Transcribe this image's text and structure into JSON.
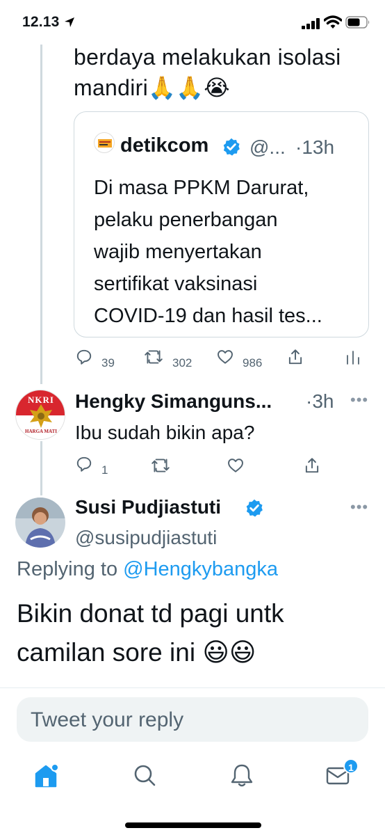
{
  "status_bar": {
    "time": "12.13"
  },
  "parent_tweet": {
    "text_line1": "berdaya melakukan isolasi",
    "text_line2": "mandiri🙏🙏😭",
    "quote": {
      "name": "detikcom",
      "handle": "@...",
      "time": "·13h",
      "lines": [
        "Di masa PPKM Darurat,",
        "pelaku penerbangan",
        "wajib menyertakan",
        "sertifikat vaksinasi",
        "COVID-19 dan hasil tes..."
      ]
    },
    "actions": {
      "replies": "39",
      "retweets": "302",
      "likes": "986"
    }
  },
  "reply_tweet": {
    "name": "Hengky Simanguns...",
    "time": "·3h",
    "avatar_text_top": "NKRI",
    "avatar_text_bottom": "HARGA MATI",
    "text": "Ibu sudah bikin apa?",
    "actions": {
      "replies": "1"
    }
  },
  "main_tweet": {
    "name": "Susi Pudjiastuti",
    "handle": "@susipudjiastuti",
    "replying_prefix": "Replying to ",
    "replying_mention": "@Hengkybangka",
    "text_line1": "Bikin donat td pagi untk",
    "text_line2": "camilan sore ini 😃😃"
  },
  "reply_input": {
    "placeholder": "Tweet your reply"
  },
  "tabbar": {
    "notifications_badge": "1"
  },
  "colors": {
    "accent": "#1d9bf0",
    "muted": "#536471",
    "text": "#0f1419"
  }
}
